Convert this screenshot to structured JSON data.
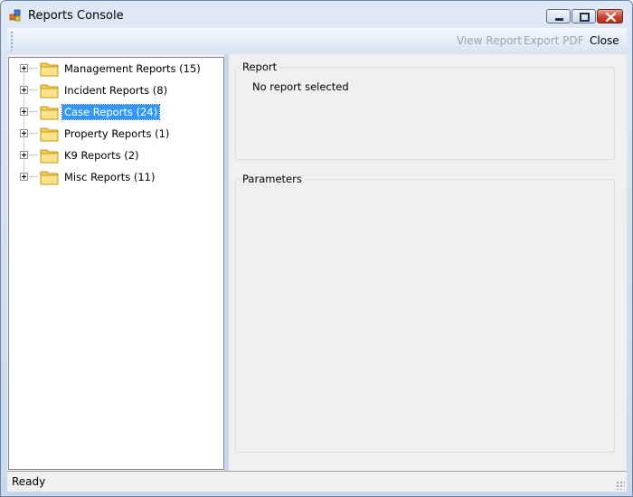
{
  "window": {
    "title": "Reports Console",
    "controls": [
      "minimize-icon",
      "maximize-icon",
      "close-icon"
    ]
  },
  "toolbar": {
    "view_report_label": "View Report",
    "view_report_enabled": false,
    "export_pdf_label": "Export PDF",
    "export_pdf_enabled": false,
    "close_label": "Close"
  },
  "tree": {
    "items": [
      {
        "label": "Management  Reports (15)",
        "icon": "folder-icon",
        "expander": "plus-icon",
        "selected": false
      },
      {
        "label": "Incident  Reports (8)",
        "icon": "folder-icon",
        "expander": "plus-icon",
        "selected": false
      },
      {
        "label": "Case Reports (24)",
        "icon": "folder-icon",
        "expander": "plus-icon",
        "selected": true
      },
      {
        "label": "Property  Reports (1)",
        "icon": "folder-icon",
        "expander": "plus-icon",
        "selected": false
      },
      {
        "label": "K9 Reports (2)",
        "icon": "folder-icon",
        "expander": "plus-icon",
        "selected": false
      },
      {
        "label": "Misc  Reports (11)",
        "icon": "folder-icon",
        "expander": "plus-icon",
        "selected": false
      }
    ]
  },
  "report_group": {
    "title": "Report",
    "text": "No report selected"
  },
  "parameters_group": {
    "title": "Parameters"
  },
  "status": {
    "text": "Ready"
  },
  "colors": {
    "selection": "#3399ff",
    "panel": "#f0f0f0",
    "disabled_text": "#a3a3a3",
    "close_button": "#c7432d"
  }
}
